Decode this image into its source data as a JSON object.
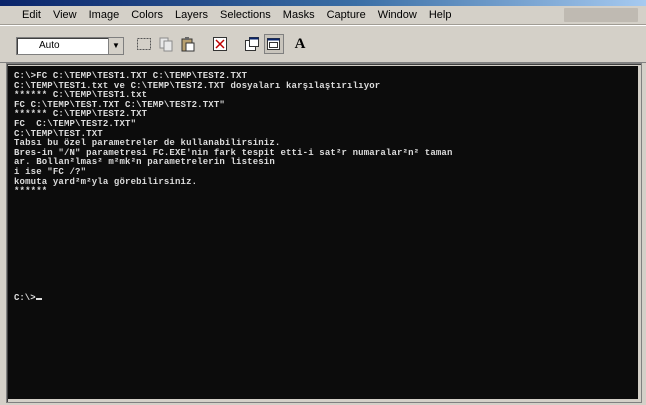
{
  "menu": {
    "items": [
      "Edit",
      "View",
      "Image",
      "Colors",
      "Layers",
      "Selections",
      "Masks",
      "Capture",
      "Window",
      "Help"
    ]
  },
  "toolbar": {
    "font_select_value": "Auto",
    "buttons": [
      "mark-icon",
      "copy-icon",
      "paste-icon",
      "fullscreen-icon",
      "properties-icon",
      "background-icon",
      "font-icon"
    ],
    "font_button_label": "A"
  },
  "console": {
    "lines": [
      "C:\\>FC C:\\TEMP\\TEST1.TXT C:\\TEMP\\TEST2.TXT",
      "C:\\TEMP\\TEST1.txt ve C:\\TEMP\\TEST2.TXT dosyaları karşılaştırılıyor",
      "****** C:\\TEMP\\TEST1.txt",
      "FC C:\\TEMP\\TEST.TXT C:\\TEMP\\TEST2.TXT\"",
      "****** C:\\TEMP\\TEST2.TXT",
      "FC  C:\\TEMP\\TEST2.TXT\"",
      "C:\\TEMP\\TEST.TXT",
      "Tabsı bu özel parametreler de kullanabilirsiniz.",
      "Bres-in \"/N\" parametresi FC.EXE'nin fark tespit etti-i sat²r numaralar²n² taman",
      "ar. Bollan²lmas² m²mk²n parametrelerin listesin",
      "i ise \"FC /?\"",
      "komuta yard²m²yla görebilirsiniz.",
      "******"
    ],
    "prompt": "C:\\>"
  },
  "colors": {
    "console_bg": "#0c0c0c",
    "console_text": "#dcdcdc",
    "chrome": "#d4d0c8"
  }
}
